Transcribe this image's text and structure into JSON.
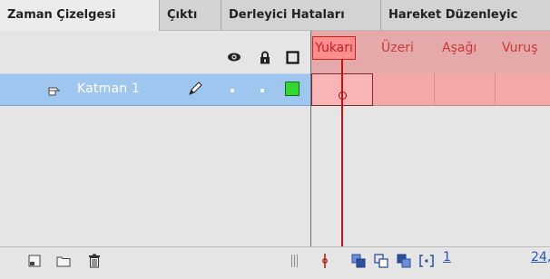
{
  "tabs": [
    {
      "label": "Zaman Çizelgesi",
      "active": true
    },
    {
      "label": "Çıktı",
      "active": false
    },
    {
      "label": "Derleyici Hataları",
      "active": false
    },
    {
      "label": "Hareket Düzenleyic",
      "active": false
    }
  ],
  "layer_header": {
    "icons": [
      "eye-icon",
      "lock-icon",
      "outline-icon"
    ]
  },
  "layers": [
    {
      "name": "Katman 1",
      "outline_color": "#33d633"
    }
  ],
  "timeline": {
    "frame_labels": [
      "Yukarı",
      "Üzeri",
      "Aşağı",
      "Vuruş"
    ],
    "current_frame": "1",
    "frame_rate": "24,"
  },
  "bottom_toolbar": {
    "icons": [
      "new-layer-icon",
      "new-folder-icon",
      "delete-icon",
      "center-frame-icon",
      "onion-skin-icon",
      "onion-skin-outlines-icon",
      "edit-multiple-frames-icon",
      "modify-markers-icon"
    ]
  },
  "colors": {
    "selected_layer": "#9fc6ef",
    "button_state_header": "#e6a9a9",
    "playhead": "#c21212"
  }
}
